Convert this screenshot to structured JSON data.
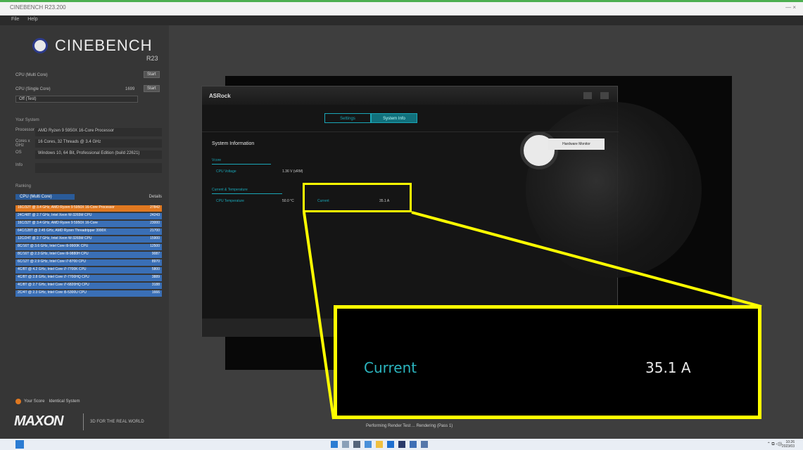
{
  "window": {
    "title": "CINEBENCH R23.200",
    "controls": "—  ×"
  },
  "menu": [
    "File",
    "Help"
  ],
  "app": {
    "name": "CINEBENCH",
    "version": "R23"
  },
  "tests": [
    {
      "label": "CPU (Multi Core)",
      "button": "Start"
    },
    {
      "label": "CPU (Single Core)",
      "score": "1699",
      "button": "Start"
    }
  ],
  "min_duration": "Off (Test)",
  "system_section": "Your System",
  "system": [
    {
      "key": "Processor",
      "value": "AMD Ryzen 9 5950X 16-Core Processor"
    },
    {
      "key": "Cores x GHz",
      "value": "16 Cores, 32 Threads @ 3.4 GHz"
    },
    {
      "key": "OS",
      "value": "Windows 10, 64 Bit, Professional Edition (build 22621)"
    },
    {
      "key": "Info",
      "value": ""
    }
  ],
  "ranking": {
    "title": "Ranking",
    "filter": "CPU (Multi Core)",
    "details": "Details",
    "rows": [
      {
        "name": "16C/32T @ 3.4 GHz, AMD Ryzen 9 5950X 16-Core Processor",
        "score": "27842",
        "highlight": true
      },
      {
        "name": "24C/48T @ 2.7 GHz, Intel Xeon W-3265M CPU",
        "score": "24243",
        "highlight": false
      },
      {
        "name": "16C/32T @ 3.4 GHz, AMD Ryzen 9 5950X 16-Core",
        "score": "23000",
        "highlight": false
      },
      {
        "name": "64C/128T @ 2.45 GHz, AMD Ryzen Threadripper 3990X",
        "score": "21700",
        "highlight": false
      },
      {
        "name": "12C/24T @ 2.7 GHz, Intel Xeon W-3265M CPU",
        "score": "15900",
        "highlight": false
      },
      {
        "name": "8C/16T @ 3.6 GHz, Intel Core i9-9900K CPU",
        "score": "12500",
        "highlight": false
      },
      {
        "name": "8C/16T @ 2.3 GHz, Intel Core i9-9880H CPU",
        "score": "9087",
        "highlight": false
      },
      {
        "name": "6C/12T @ 2.9 GHz, Intel Core i7-8700 CPU",
        "score": "8970",
        "highlight": false
      },
      {
        "name": "4C/8T @ 4.2 GHz, Intel Core i7-7700K CPU",
        "score": "5800",
        "highlight": false
      },
      {
        "name": "4C/8T @ 2.8 GHz, Intel Core i7-7700HQ CPU",
        "score": "3889",
        "highlight": false
      },
      {
        "name": "4C/8T @ 2.7 GHz, Intel Core i7-6820HQ CPU",
        "score": "3188",
        "highlight": false
      },
      {
        "name": "2C/4T @ 2.3 GHz, Intel Core i5-5300U CPU",
        "score": "1666",
        "highlight": false
      }
    ]
  },
  "your_score": "Your Score",
  "identical": "Identical System",
  "maxon": {
    "logo": "MAXON",
    "tagline": "3D FOR THE REAL WORLD"
  },
  "status": "Performing Render Test ... Rendering (Pass 1)",
  "asrock": {
    "brand": "ASRock",
    "tabs": [
      "Settings",
      "System Info"
    ],
    "active_tab": 1,
    "section": "System Information",
    "hw_button": "Hardware Monitor",
    "labels": {
      "voltage_group": "Vcore",
      "voltage_key": "CPU Voltage",
      "voltage_value": "1.36 V (vRM)",
      "current_group": "Current & Temperature",
      "temp_key": "CPU Temperature",
      "temp_value": "50.0 °C",
      "current_key": "Current",
      "current_value": "35.1 A"
    }
  },
  "callout": {
    "label": "Current",
    "value": "35.1 A"
  },
  "colors": {
    "accent": "#1aa6b7",
    "highlight": "#ffff00",
    "rank_selected": "#e07820",
    "rank_row": "#3a6fb6"
  },
  "taskbar": {
    "time": "10:26",
    "date": "2023/03"
  }
}
